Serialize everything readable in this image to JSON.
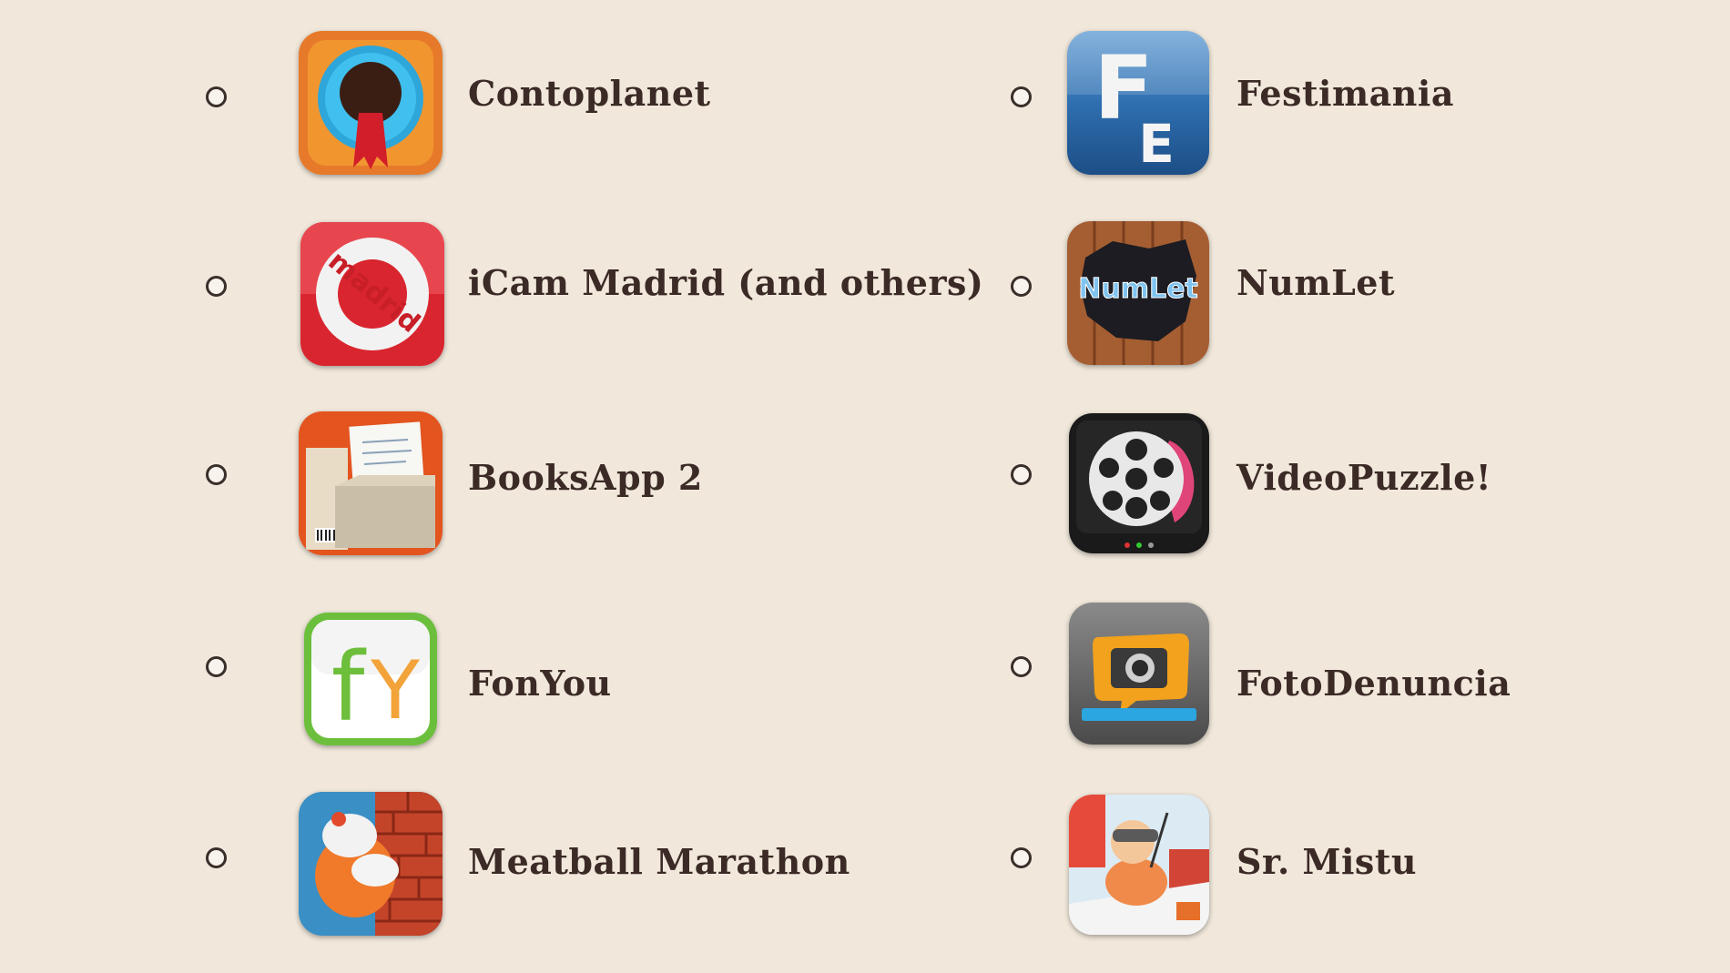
{
  "options_left": [
    {
      "label": "Contoplanet",
      "icon": "contoplanet-icon"
    },
    {
      "label": "iCam Madrid (and others)",
      "icon": "icam-madrid-icon"
    },
    {
      "label": "BooksApp 2",
      "icon": "booksapp-icon"
    },
    {
      "label": "FonYou",
      "icon": "fonyou-icon"
    },
    {
      "label": "Meatball Marathon",
      "icon": "meatball-marathon-icon"
    }
  ],
  "options_right": [
    {
      "label": "Festimania",
      "icon": "festimania-icon"
    },
    {
      "label": "NumLet",
      "icon": "numlet-icon"
    },
    {
      "label": "VideoPuzzle!",
      "icon": "videopuzzle-icon"
    },
    {
      "label": "FotoDenuncia",
      "icon": "fotodenuncia-icon"
    },
    {
      "label": "Sr. Mistu",
      "icon": "sr-mistu-icon"
    }
  ],
  "icon_text": {
    "madrid": "madrid",
    "fonyou_f": "f",
    "fonyou_y": "Y",
    "festimania_f": "F",
    "festimania_e": "E",
    "numlet": "NumLet"
  },
  "colors": {
    "background": "#F1E8DB",
    "label_text": "#3B2A26",
    "radio_border": "#3A2E2A"
  }
}
